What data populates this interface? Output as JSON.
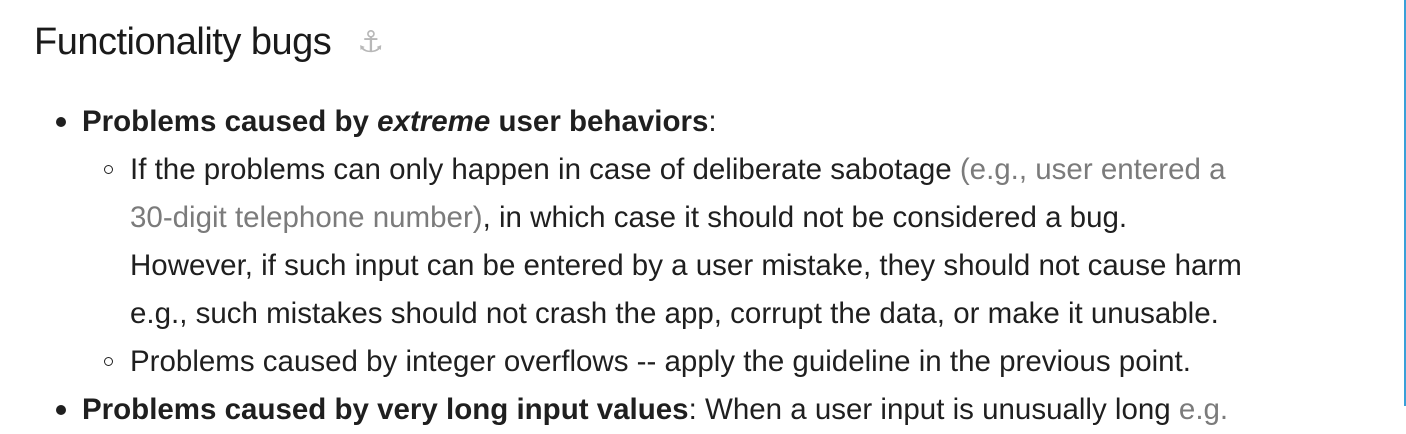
{
  "heading": "Functionality bugs",
  "anchor_icon": "⚓",
  "item1": {
    "bold_before": "Problems caused by ",
    "bold_italic": "extreme",
    "bold_after": " user behaviors",
    "colon": ":"
  },
  "sub1": {
    "l1_text": "If the problems can only happen in case of deliberate sabotage ",
    "l1_muted": "(e.g., user entered a",
    "l2_muted": "30-digit telephone number)",
    "l2_text": ", in which case it should not be considered a bug.",
    "l3": "However, if such input can be entered by a user mistake, they should not cause harm",
    "l4": "e.g., such mistakes should not crash the app, corrupt the data, or make it unusable."
  },
  "sub2": "Problems caused by integer overflows -- apply the guideline in the previous point.",
  "item2": {
    "bold": "Problems caused by very long input values",
    "text": ": When a user input is unusually long ",
    "muted": "e.g."
  }
}
